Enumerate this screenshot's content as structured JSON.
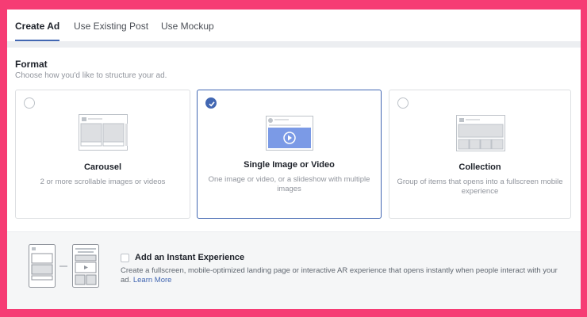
{
  "tabs": [
    {
      "label": "Create Ad",
      "active": true
    },
    {
      "label": "Use Existing Post",
      "active": false
    },
    {
      "label": "Use Mockup",
      "active": false
    }
  ],
  "format": {
    "title": "Format",
    "subtitle": "Choose how you'd like to structure your ad.",
    "options": [
      {
        "title": "Carousel",
        "description": "2 or more scrollable images or videos",
        "selected": false
      },
      {
        "title": "Single Image or Video",
        "description": "One image or video, or a slideshow with multiple images",
        "selected": true
      },
      {
        "title": "Collection",
        "description": "Group of items that opens into a fullscreen mobile experience",
        "selected": false
      }
    ]
  },
  "instant_experience": {
    "title": "Add an Instant Experience",
    "description": "Create a fullscreen, mobile-optimized landing page or interactive AR experience that opens instantly when people interact with your ad.",
    "link": "Learn More",
    "checked": false
  },
  "colors": {
    "frame": "#f63c74",
    "accent": "#4267b2"
  }
}
